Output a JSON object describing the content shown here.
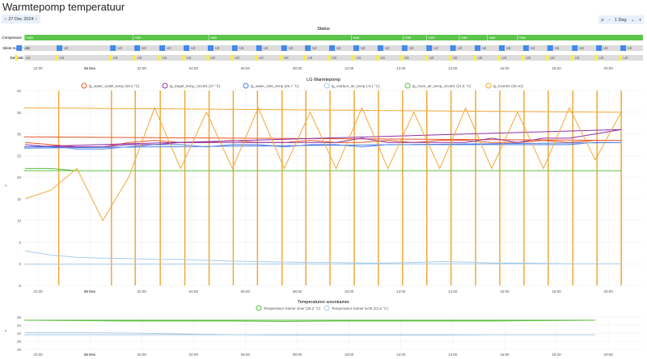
{
  "header": {
    "title": "Warmtepomp temperatuur",
    "date": "27 Dec 2024",
    "prev_icon": "chevron-left-icon",
    "next_icon": "chevron-right-icon",
    "zoom_icon": "zoom-icon",
    "range": "1 Dag",
    "range_minus": "-",
    "range_plus": "+"
  },
  "chart_data": [
    {
      "type": "timeline",
      "title": "Status",
      "rows": [
        {
          "label": "Compressor",
          "base_label": "Aan",
          "base_color": "#5cc44b",
          "segments_start": [
            "21:30",
            "01:40",
            "04:35",
            "10:05",
            "12:05",
            "13:00",
            "14:15",
            "15:20",
            "16:30"
          ]
        },
        {
          "label": "Silent mode",
          "base_label": "Uit",
          "base_color": "#dcdcdc",
          "block_color": "#4488ee",
          "blocks": [
            "22:43",
            "00:47",
            "01:43",
            "02:41",
            "03:37",
            "04:33",
            "05:29",
            "06:25",
            "07:23",
            "08:18",
            "09:14",
            "10:10",
            "11:06",
            "12:02",
            "12:59",
            "13:54",
            "14:51",
            "15:47",
            "16:43",
            "17:39",
            "18:36",
            "19:32",
            "20:28",
            "21:10"
          ]
        },
        {
          "label": "Defrost",
          "base_label": "Uit",
          "base_color": "#dcdcdc",
          "block_color": "#f5f03c",
          "blocks": [
            "22:40",
            "00:44",
            "01:40",
            "02:38",
            "03:34",
            "04:30",
            "05:26",
            "06:22",
            "07:20",
            "08:15",
            "09:11",
            "10:07",
            "11:03",
            "11:59",
            "12:56",
            "13:51",
            "14:48",
            "15:44",
            "16:40",
            "17:36",
            "18:33",
            "19:29",
            "20:25",
            "21:07"
          ]
        }
      ],
      "xticks": [
        "22:00",
        "26 Dec",
        "02:00",
        "04:00",
        "06:00",
        "08:00",
        "10:00",
        "12:00",
        "14:00",
        "16:00",
        "18:00",
        "20:00"
      ]
    },
    {
      "type": "line",
      "title": "LG Warmtepomp",
      "ylabel": "°",
      "ylim": [
        -5,
        40
      ],
      "yticks": [
        40,
        35,
        30,
        25,
        20,
        15,
        10,
        5,
        0,
        -5
      ],
      "xticks": [
        "22:00",
        "26 Dec",
        "02:00",
        "04:00",
        "06:00",
        "08:00",
        "10:00",
        "12:00",
        "14:00",
        "16:00",
        "18:00",
        "20:00"
      ],
      "x": [
        "21:30",
        "22:30",
        "23:30",
        "00:30",
        "01:30",
        "02:30",
        "03:30",
        "04:30",
        "05:30",
        "06:30",
        "07:30",
        "08:30",
        "09:30",
        "10:30",
        "11:30",
        "12:30",
        "13:30",
        "14:30",
        "15:30",
        "16:30",
        "17:30",
        "18:30",
        "19:30",
        "20:30",
        "21:20"
      ],
      "series": [
        {
          "name": "lg_water_outlet_temp (29.3 °C)",
          "color": "#e8552a",
          "values": [
            28,
            27.5,
            27,
            27,
            28,
            28.5,
            28,
            28,
            28.5,
            28,
            28,
            28.5,
            28,
            28,
            28.5,
            28,
            28.5,
            28.5,
            28,
            28,
            28.5,
            28,
            28.5,
            28.5,
            29.3
          ]
        },
        {
          "name": "lg_target_temp_circuit1 (27 °C)",
          "color": "#8e2fa8",
          "values": [
            27.5,
            27,
            27,
            27,
            27.5,
            27.5,
            28,
            28,
            28,
            28,
            28,
            28,
            28,
            29,
            28,
            28,
            28,
            28,
            29,
            28,
            29,
            29,
            30,
            31,
            27
          ]
        },
        {
          "name": "lg_water_inlet_temp (26.7 °C)",
          "color": "#4a7fe8",
          "values": [
            27,
            27,
            26.5,
            26.5,
            27,
            27.5,
            27.5,
            27,
            27.5,
            27.5,
            27,
            27.5,
            27.5,
            27,
            27.5,
            27.5,
            27.5,
            27.5,
            27.5,
            27.5,
            27.5,
            27.5,
            28,
            28,
            26.7
          ]
        },
        {
          "name": "lg_outdoor_air_temp (-0.1 °C)",
          "color": "#a9cbe6",
          "values": [
            3,
            2,
            1.5,
            1.3,
            1.2,
            1,
            1,
            0.8,
            0.6,
            0.5,
            0.4,
            0.3,
            0.3,
            0.2,
            0.2,
            0.3,
            0.5,
            0.4,
            0.2,
            0.2,
            0.1,
            0,
            0,
            0,
            -0.1
          ]
        },
        {
          "name": "lg_room_air_temp_circuit1 (21.5 °C)",
          "color": "#5cbf3c",
          "values": [
            22,
            22,
            21.5,
            21.5,
            21.5,
            21.5,
            21.5,
            21.5,
            21.5,
            21.5,
            21.5,
            21.5,
            21.5,
            21.5,
            21.5,
            21.5,
            21.5,
            21.5,
            21.5,
            21.5,
            21.5,
            21.5,
            21.5,
            21.5,
            21.5
          ]
        },
        {
          "name": "lg_inverter (36 Hz)",
          "color": "#f0a838",
          "values": [
            15,
            17,
            22,
            10,
            20,
            36,
            22,
            35,
            22,
            36,
            22,
            35,
            22,
            36,
            22,
            35,
            22,
            36,
            22,
            35,
            22,
            36,
            24,
            35,
            36
          ]
        }
      ],
      "spikes_color": "#f0a838",
      "spikes_value": 40,
      "spikes": [
        "22:48",
        "00:50",
        "01:45",
        "02:43",
        "03:40",
        "04:36",
        "05:32",
        "06:28",
        "07:25",
        "08:20",
        "09:16",
        "10:12",
        "11:08",
        "12:04",
        "13:00",
        "13:56",
        "14:53",
        "15:49",
        "16:45",
        "17:41",
        "18:38",
        "19:34",
        "20:30"
      ]
    },
    {
      "type": "line",
      "title": "Temperaturen woonkamer",
      "ylabel": "°",
      "ylim": [
        18,
        26
      ],
      "yticks": [
        26,
        24,
        22,
        20,
        18
      ],
      "xticks": [
        "22:00",
        "26 Dec",
        "02:00",
        "04:00",
        "06:00",
        "08:00",
        "10:00",
        "12:00",
        "14:00",
        "16:00",
        "18:00",
        "20:00"
      ],
      "x": [
        "21:30",
        "23:30",
        "01:30",
        "03:30",
        "05:30",
        "07:30",
        "09:30",
        "11:30",
        "13:30",
        "15:30",
        "17:30",
        "19:30",
        "21:20"
      ],
      "series": [
        {
          "name": "Temperatuur Kamer vloer (25.2 °C)",
          "color": "#5cbf3c",
          "values": [
            25.2,
            25.1,
            25,
            25,
            25,
            24.9,
            25,
            25,
            25,
            25,
            25.1,
            25.2,
            25.2
          ]
        },
        {
          "name": "Temperatuur Kamer lucht (21.6 °C)",
          "color": "#a9cbe6",
          "values": [
            22.1,
            22.1,
            22,
            21.8,
            21.6,
            21.5,
            21.5,
            21.5,
            21.5,
            21.6,
            21.6,
            21.6,
            21.6
          ]
        }
      ]
    }
  ]
}
